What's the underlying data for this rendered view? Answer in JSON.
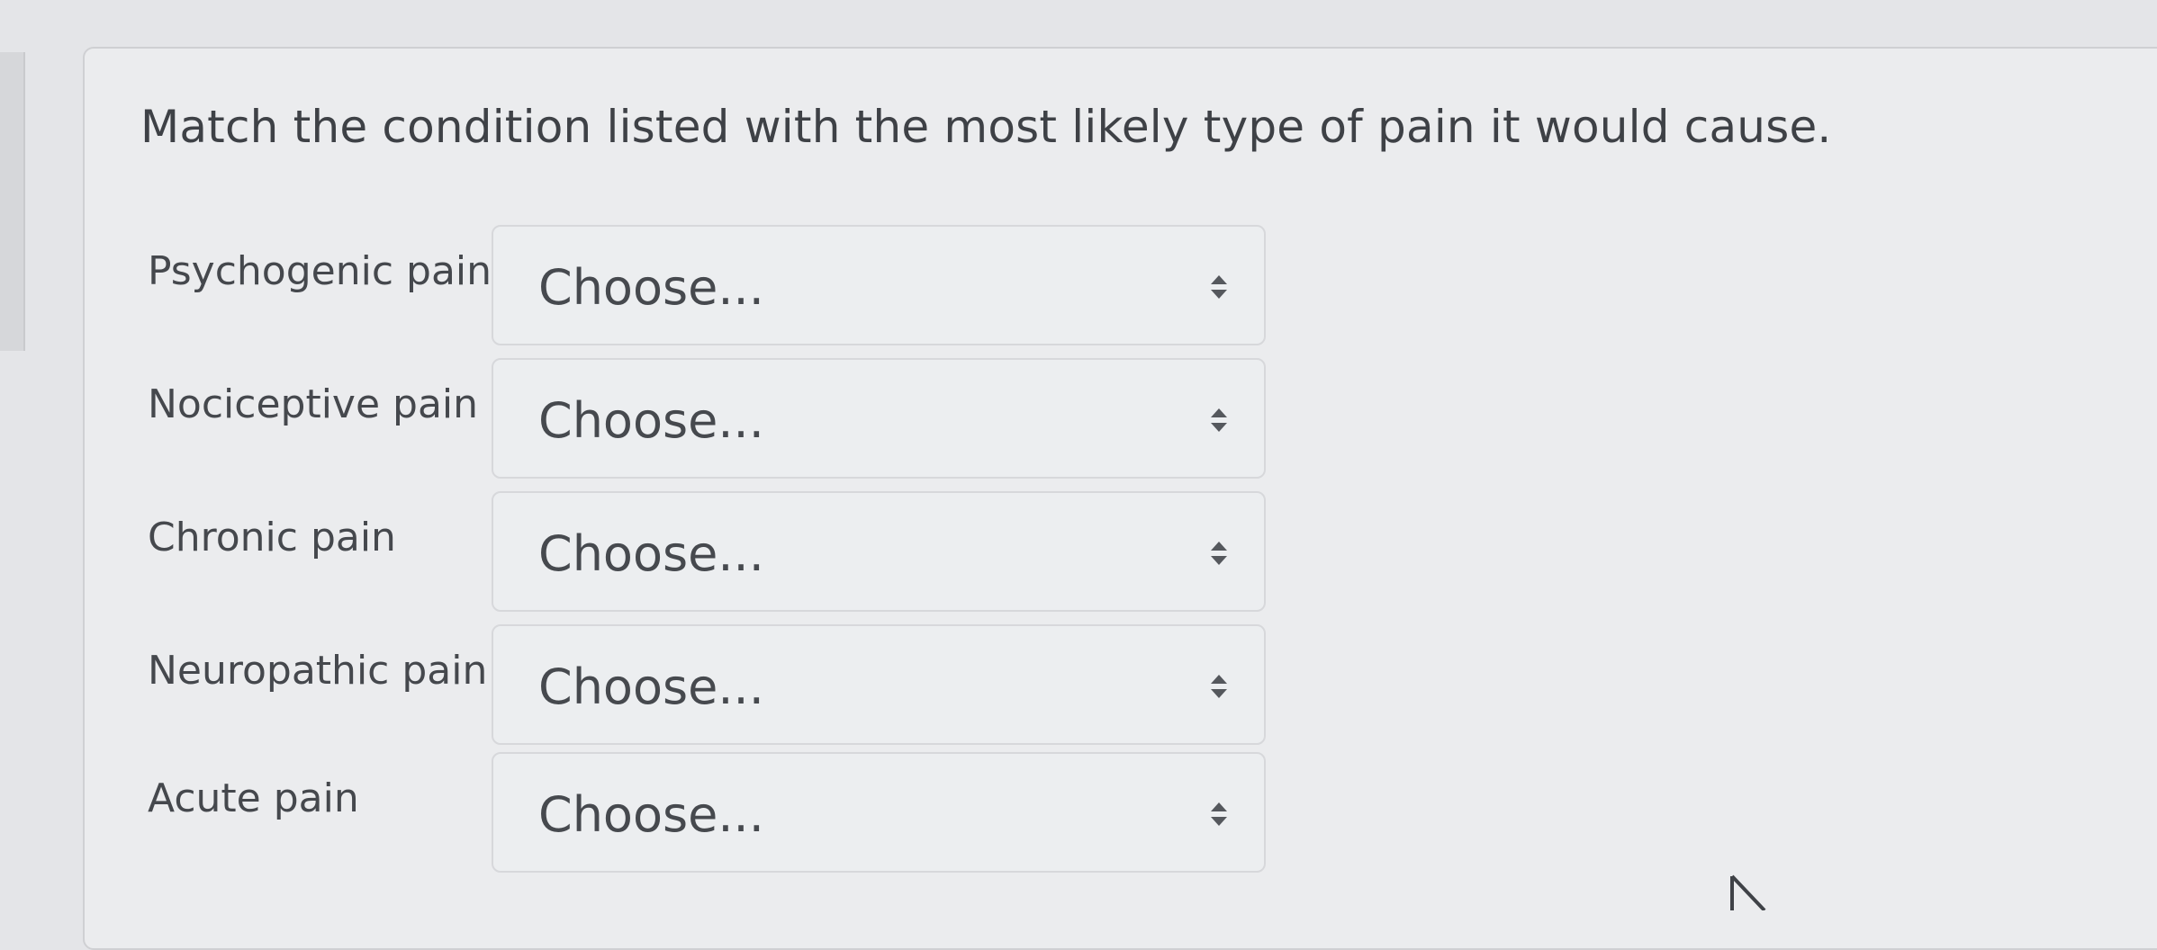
{
  "question": {
    "text": "Match the condition listed with the most likely type of pain it would cause."
  },
  "rows": [
    {
      "label": "Psychogenic pain",
      "selected": "Choose..."
    },
    {
      "label": "Nociceptive pain",
      "selected": "Choose..."
    },
    {
      "label": "Chronic pain",
      "selected": "Choose..."
    },
    {
      "label": "Neuropathic pain",
      "selected": "Choose..."
    },
    {
      "label": "Acute pain",
      "selected": "Choose..."
    }
  ],
  "icons": {
    "select_arrow": "sort-arrows-icon",
    "cursor": "mouse-pointer-icon"
  }
}
